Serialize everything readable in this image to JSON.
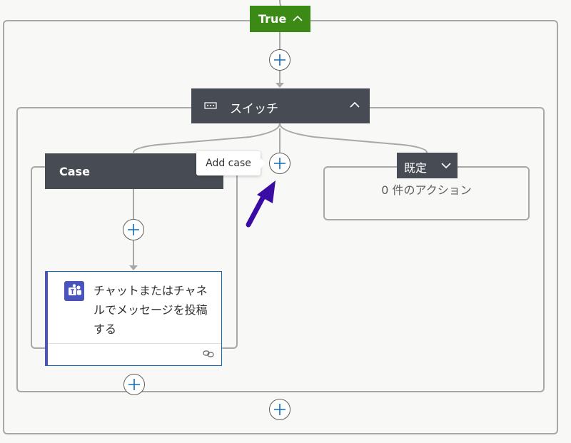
{
  "true_branch": {
    "label": "True",
    "collapse_icon": "chevron-up-icon",
    "color": "#3c8a16"
  },
  "switch_action": {
    "title": "スイッチ",
    "icon": "switch-icon",
    "collapse_icon": "chevron-up-icon",
    "color": "#474c54"
  },
  "case": {
    "label": "Case"
  },
  "add_case_tooltip": "Add case",
  "default_case": {
    "label": "既定",
    "expand_icon": "chevron-down-icon",
    "empty_text": "0 件のアクション"
  },
  "teams_action": {
    "title": "チャットまたはチャネルでメッセージを投稿する",
    "icon": "teams-icon",
    "footer_icon": "link-icon",
    "accent": "#4b53bc"
  },
  "add_step_icon": "plus-icon",
  "accent_color": "#0f6cbd"
}
